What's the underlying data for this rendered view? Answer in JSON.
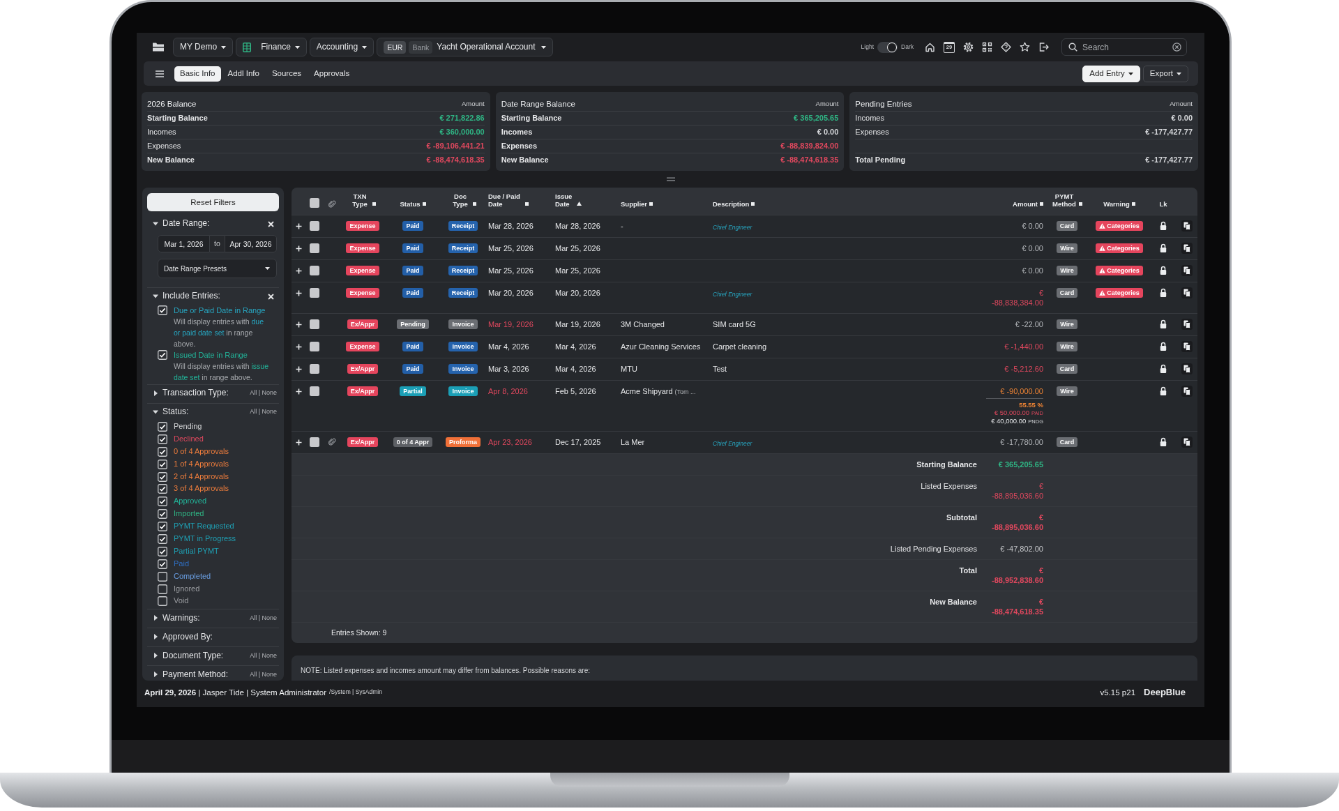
{
  "top_bar": {
    "menus": [
      {
        "label": "MY Demo",
        "kind": "plain"
      },
      {
        "label": "Finance",
        "kind": "spreadsheet"
      },
      {
        "label": "Accounting",
        "kind": "plain"
      }
    ],
    "account": {
      "currency": "EUR",
      "type": "Bank",
      "name": "Yacht Operational Account"
    },
    "theme": {
      "light_label": "Light",
      "dark_label": "Dark",
      "dark": true
    },
    "calendar_day": "29",
    "search": {
      "placeholder": "Search"
    }
  },
  "tabs": [
    {
      "label": "Basic Info",
      "selected": true
    },
    {
      "label": "Addl Info",
      "selected": false
    },
    {
      "label": "Sources",
      "selected": false
    },
    {
      "label": "Approvals",
      "selected": false
    }
  ],
  "actions": [
    {
      "label": "Add Entry",
      "kind": "primary"
    },
    {
      "label": "Export",
      "kind": "outline"
    }
  ],
  "balances": [
    {
      "title": "2026 Balance",
      "amount_heading": "Amount",
      "rows": [
        {
          "label": "Starting Balance",
          "value": "€ 271,822.86",
          "bold": true,
          "color": "#2fb584"
        },
        {
          "label": "Incomes",
          "value": "€ 360,000.00",
          "bold": false,
          "color": "#2fb584"
        },
        {
          "label": "Expenses",
          "value": "€ -89,106,441.21",
          "bold": false,
          "color": "#e0485e"
        }
      ],
      "total": {
        "label": "New Balance",
        "value": "€ -88,474,618.35",
        "color": "#e0485e"
      }
    },
    {
      "title": "Date Range Balance",
      "amount_heading": "Amount",
      "rows": [
        {
          "label": "Starting Balance",
          "value": "€ 365,205.65",
          "bold": true,
          "color": "#2fb584"
        },
        {
          "label": "Incomes",
          "value": "€ 0.00",
          "bold": true,
          "color": "#d4d6d9"
        },
        {
          "label": "Expenses",
          "value": "€ -88,839,824.00",
          "bold": true,
          "color": "#e0485e"
        }
      ],
      "total": {
        "label": "New Balance",
        "value": "€ -88,474,618.35",
        "color": "#e0485e"
      }
    },
    {
      "title": "Pending Entries",
      "amount_heading": "Amount",
      "rows": [
        {
          "label": "Incomes",
          "value": "€ 0.00",
          "bold": false,
          "color": "#d4d6d9"
        },
        {
          "label": "Expenses",
          "value": "€ -177,427.77",
          "bold": false,
          "color": "#d4d6d9"
        }
      ],
      "total": {
        "label": "Total Pending",
        "value": "€ -177,427.77",
        "color": "#d4d6d9"
      }
    }
  ],
  "filters": {
    "reset_label": "Reset Filters",
    "sections": [
      {
        "kind": "date_range",
        "title": "Date Range:",
        "expanded": true,
        "from": "Mar 1, 2026",
        "joiner": "to",
        "to": "Apr 30, 2026",
        "presets": "Date Range Presets"
      },
      {
        "kind": "include",
        "title": "Include Entries:",
        "expanded": true,
        "options": [
          {
            "label": "Due or Paid Date in Range",
            "checked": true,
            "color": "#27a7c2",
            "help": "Will display entries with **due or paid date set** in range above."
          },
          {
            "label": "Issued Date in Range",
            "checked": true,
            "color": "#22b59a",
            "help": "Will display entries with **issue date set** in range above."
          }
        ]
      },
      {
        "kind": "checklist",
        "title": "Transaction Type:",
        "expanded": false,
        "all_none": "All | None"
      },
      {
        "kind": "checklist",
        "title": "Status:",
        "expanded": true,
        "all_none": "All | None",
        "options": [
          {
            "label": "Pending",
            "checked": true,
            "color": "#d4d5d7"
          },
          {
            "label": "Declined",
            "checked": true,
            "color": "#e0485e"
          },
          {
            "label": "0 of 4 Approvals",
            "checked": true,
            "color": "#ef7d3c"
          },
          {
            "label": "1 of 4 Approvals",
            "checked": true,
            "color": "#ef7d3c"
          },
          {
            "label": "2 of 4 Approvals",
            "checked": true,
            "color": "#ef7d3c"
          },
          {
            "label": "3 of 4 Approvals",
            "checked": true,
            "color": "#ef7d3c"
          },
          {
            "label": "Approved",
            "checked": true,
            "color": "#22b59a"
          },
          {
            "label": "Imported",
            "checked": true,
            "color": "#2fb584"
          },
          {
            "label": "PYMT Requested",
            "checked": true,
            "color": "#1fa0b4"
          },
          {
            "label": "PYMT in Progress",
            "checked": true,
            "color": "#1fa0b4"
          },
          {
            "label": "Partial PYMT",
            "checked": true,
            "color": "#1fa0b4"
          },
          {
            "label": "Paid",
            "checked": true,
            "color": "#2f6fc4"
          },
          {
            "label": "Completed",
            "checked": false,
            "color": "#6a9fe3"
          },
          {
            "label": "Ignored",
            "checked": false,
            "color": "#9c9ea2"
          },
          {
            "label": "Void",
            "checked": false,
            "color": "#9c9ea2"
          }
        ]
      },
      {
        "kind": "checklist",
        "title": "Warnings:",
        "expanded": false,
        "all_none": "All | None"
      },
      {
        "kind": "checklist",
        "title": "Approved By:",
        "expanded": false
      },
      {
        "kind": "checklist",
        "title": "Document Type:",
        "expanded": false,
        "all_none": "All | None"
      },
      {
        "kind": "checklist",
        "title": "Payment Method:",
        "expanded": false,
        "all_none": "All | None"
      }
    ]
  },
  "table": {
    "all_checked": false,
    "columns": [
      {
        "label": "TXN Type",
        "sortable": true,
        "sorted": false
      },
      {
        "label": "Status",
        "sortable": true,
        "sorted": false
      },
      {
        "label": "Doc Type",
        "sortable": true,
        "sorted": false
      },
      {
        "label": "Due / Paid Date",
        "sortable": true,
        "sorted": false
      },
      {
        "label": "Issue Date",
        "sortable": true,
        "sorted": true
      },
      {
        "label": "Supplier",
        "sortable": true,
        "sorted": false
      },
      {
        "label": "Description",
        "sortable": true,
        "sorted": false
      },
      {
        "label": "Amount",
        "sortable": true,
        "sorted": false
      },
      {
        "label": "PYMT Method",
        "sortable": true,
        "sorted": false
      },
      {
        "label": "Warning",
        "sortable": true,
        "sorted": false
      },
      {
        "label": "Lk",
        "sortable": false
      }
    ],
    "rows": [
      {
        "checked": false,
        "attachment": false,
        "txn_type": {
          "label": "Expense",
          "color": "#e5455d"
        },
        "status": {
          "label": "Paid",
          "color": "#235fa8"
        },
        "doc_type": {
          "label": "Receipt",
          "color": "#2563ad"
        },
        "due_date": "Mar 28, 2026",
        "overdue": false,
        "issue_date": "Mar 28, 2026",
        "supplier": "-",
        "note": "Chief Engineer",
        "amount": {
          "value": "€ 0.00",
          "color": "#b3b6ba"
        },
        "method": "Card",
        "warning": "Categories",
        "locked": true
      },
      {
        "checked": false,
        "attachment": false,
        "txn_type": {
          "label": "Expense",
          "color": "#e5455d"
        },
        "status": {
          "label": "Paid",
          "color": "#235fa8"
        },
        "doc_type": {
          "label": "Receipt",
          "color": "#2563ad"
        },
        "due_date": "Mar 25, 2026",
        "overdue": false,
        "issue_date": "Mar 25, 2026",
        "amount": {
          "value": "€ 0.00",
          "color": "#b3b6ba"
        },
        "method": "Wire",
        "warning": "Categories",
        "locked": true
      },
      {
        "checked": false,
        "attachment": false,
        "txn_type": {
          "label": "Expense",
          "color": "#e5455d"
        },
        "status": {
          "label": "Paid",
          "color": "#235fa8"
        },
        "doc_type": {
          "label": "Receipt",
          "color": "#2563ad"
        },
        "due_date": "Mar 25, 2026",
        "overdue": false,
        "issue_date": "Mar 25, 2026",
        "amount": {
          "value": "€ 0.00",
          "color": "#b3b6ba"
        },
        "method": "Wire",
        "warning": "Categories",
        "locked": true
      },
      {
        "checked": false,
        "attachment": false,
        "txn_type": {
          "label": "Expense",
          "color": "#e5455d"
        },
        "status": {
          "label": "Paid",
          "color": "#235fa8"
        },
        "doc_type": {
          "label": "Receipt",
          "color": "#2563ad"
        },
        "due_date": "Mar 20, 2026",
        "overdue": false,
        "issue_date": "Mar 20, 2026",
        "note": "Chief Engineer",
        "amount": {
          "value": "€ -88,838,384.00",
          "color": "#e0485e"
        },
        "method": "Card",
        "warning": "Categories",
        "locked": true
      },
      {
        "checked": false,
        "attachment": false,
        "txn_type": {
          "label": "Ex/Appr",
          "color": "#e5455d"
        },
        "status": {
          "label": "Pending",
          "color": "#6b6e73"
        },
        "doc_type": {
          "label": "Invoice",
          "color": "#6b6e73"
        },
        "due_date": "Mar 19, 2026",
        "overdue": true,
        "issue_date": "Mar 19, 2026",
        "supplier": "3M Changed",
        "description": "SIM card 5G",
        "amount": {
          "value": "€ -22.00",
          "color": "#b3b6ba"
        },
        "method": "Wire",
        "locked": true
      },
      {
        "checked": false,
        "attachment": false,
        "txn_type": {
          "label": "Expense",
          "color": "#e5455d"
        },
        "status": {
          "label": "Paid",
          "color": "#235fa8"
        },
        "doc_type": {
          "label": "Invoice",
          "color": "#2563ad"
        },
        "due_date": "Mar 4, 2026",
        "overdue": false,
        "issue_date": "Mar 4, 2026",
        "supplier": "Azur Cleaning Services",
        "description": "Carpet cleaning",
        "amount": {
          "value": "€ -1,440.00",
          "color": "#e0485e"
        },
        "method": "Wire",
        "locked": true
      },
      {
        "checked": false,
        "attachment": false,
        "txn_type": {
          "label": "Ex/Appr",
          "color": "#e5455d"
        },
        "status": {
          "label": "Paid",
          "color": "#235fa8"
        },
        "doc_type": {
          "label": "Invoice",
          "color": "#2563ad"
        },
        "due_date": "Mar 3, 2026",
        "overdue": false,
        "issue_date": "Mar 4, 2026",
        "supplier": "MTU",
        "description": "Test",
        "amount": {
          "value": "€ -5,212.60",
          "color": "#e0485e"
        },
        "method": "Card",
        "locked": true
      },
      {
        "checked": false,
        "attachment": false,
        "txn_type": {
          "label": "Ex/Appr",
          "color": "#e5455d"
        },
        "status": {
          "label": "Partial",
          "color": "#1b9fb6"
        },
        "doc_type": {
          "label": "Invoice",
          "color": "#1b9fb6"
        },
        "due_date": "Apr 8, 2026",
        "overdue": true,
        "issue_date": "Feb 5, 2026",
        "supplier": "Acme Shipyard",
        "supplier_contact": "(Tom ...",
        "amount": {
          "value": "€ -90,000.00",
          "color": "#ef8434"
        },
        "payment": {
          "percent": "55.55 %",
          "paid": "€ 50,000.00",
          "paid_tag": "PAID",
          "pending": "€ 40,000.00",
          "pending_tag": "PNDG"
        },
        "method": "Wire",
        "locked": true
      },
      {
        "checked": false,
        "attachment": true,
        "txn_type": {
          "label": "Ex/Appr",
          "color": "#e5455d"
        },
        "status": {
          "label": "0 of 4 Appr",
          "color": "#5d6065"
        },
        "doc_type": {
          "label": "Proforma",
          "color": "#f07038"
        },
        "due_date": "Apr 23, 2026",
        "overdue": true,
        "issue_date": "Dec 17, 2025",
        "supplier": "La Mer",
        "note": "Chief Engineer",
        "amount": {
          "value": "€ -17,780.00",
          "color": "#b3b6ba"
        },
        "method": "Card",
        "locked": true
      }
    ],
    "summary": [
      {
        "label": "Starting Balance",
        "value": "€ 365,205.65",
        "bold": true,
        "color": "#2fb584"
      },
      {
        "label": "Listed Expenses",
        "value": "€ -88,895,036.60",
        "bold": false,
        "color": "#e0485e"
      },
      {
        "label": "Subtotal",
        "value": "€ -88,895,036.60",
        "bold": true,
        "color": "#e0485e"
      },
      {
        "label": "Listed Pending Expenses",
        "value": "€ -47,802.00",
        "bold": false,
        "color": "#c4c6c9"
      },
      {
        "label": "Total",
        "value": "€ -88,952,838.60",
        "bold": true,
        "color": "#e0485e"
      },
      {
        "label": "New Balance",
        "value": "€ -88,474,618.35",
        "bold": true,
        "color": "#e0485e"
      }
    ],
    "entries_shown": "Entries Shown: 9"
  },
  "note": "NOTE: Listed expenses and incomes amount may differ from balances. Possible reasons are:",
  "footer": {
    "user": "**April 29, 2026** | Jasper Tide | System Administrator",
    "role_path": "/System | SysAdmin",
    "version": "v5.15 p21",
    "brand": "DeepBlue"
  }
}
